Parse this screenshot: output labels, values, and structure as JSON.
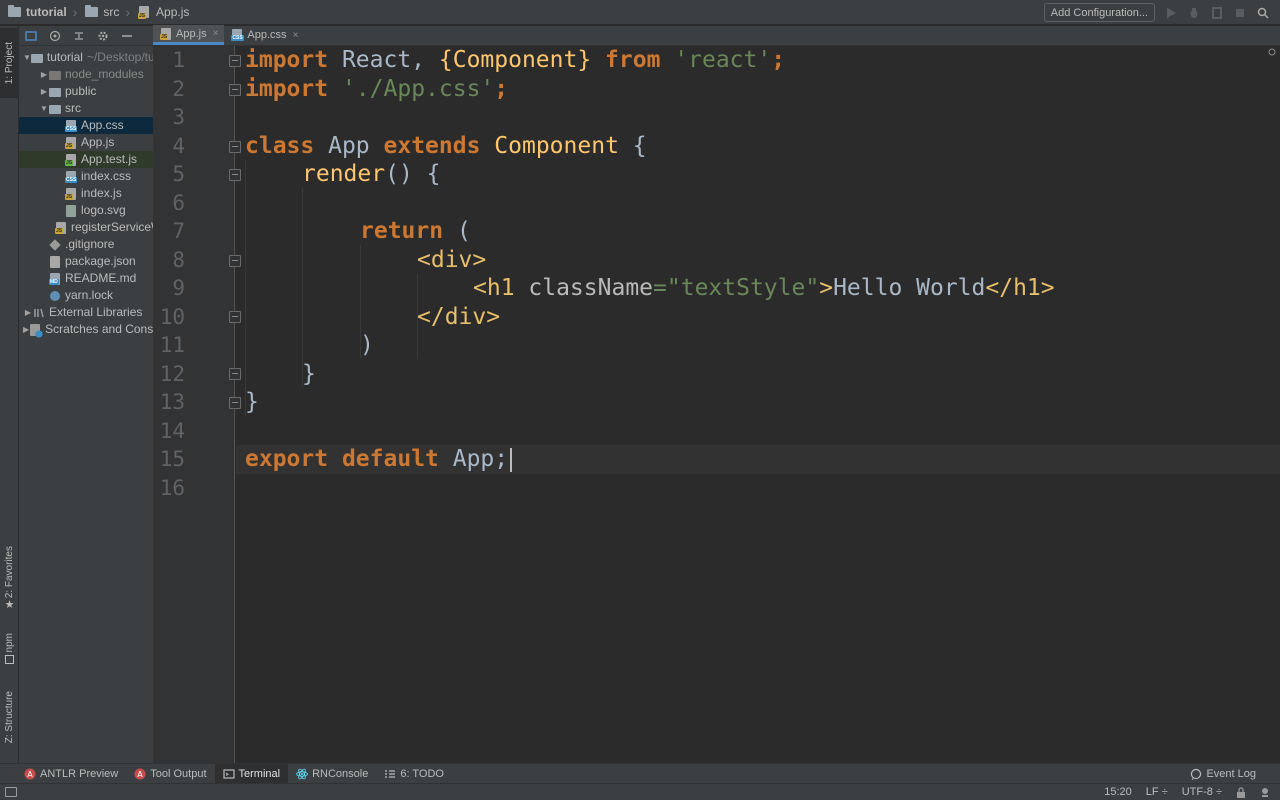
{
  "breadcrumb": {
    "items": [
      {
        "label": "tutorial",
        "icon": "folder-icon"
      },
      {
        "label": "src",
        "icon": "folder-icon"
      },
      {
        "label": "App.js",
        "icon": "js-file-icon"
      }
    ]
  },
  "toolbar": {
    "add_configuration": "Add Configuration..."
  },
  "left_stripe": {
    "project": "1: Project",
    "favorites": "2: Favorites",
    "npm": "npm",
    "structure": "Z: Structure"
  },
  "project_tree": [
    {
      "label": "tutorial",
      "hint": "~/Desktop/tutorial",
      "indent": 0,
      "expanded": true,
      "icon": "folder-icon"
    },
    {
      "label": "node_modules",
      "indent": 1,
      "expanded": false,
      "icon": "folder-icon",
      "muted": true
    },
    {
      "label": "public",
      "indent": 1,
      "expanded": false,
      "icon": "folder-icon"
    },
    {
      "label": "src",
      "indent": 1,
      "expanded": true,
      "icon": "folder-icon"
    },
    {
      "label": "App.css",
      "indent": 2,
      "icon": "css-file-icon",
      "selected": true
    },
    {
      "label": "App.js",
      "indent": 2,
      "icon": "js-file-icon"
    },
    {
      "label": "App.test.js",
      "indent": 2,
      "icon": "test-file-icon",
      "highlight": true
    },
    {
      "label": "index.css",
      "indent": 2,
      "icon": "css-file-icon"
    },
    {
      "label": "index.js",
      "indent": 2,
      "icon": "js-file-icon"
    },
    {
      "label": "logo.svg",
      "indent": 2,
      "icon": "svg-file-icon"
    },
    {
      "label": "registerServiceWorker.js",
      "indent": 2,
      "icon": "js-file-icon"
    },
    {
      "label": ".gitignore",
      "indent": 1,
      "icon": "git-icon"
    },
    {
      "label": "package.json",
      "indent": 1,
      "icon": "json-file-icon"
    },
    {
      "label": "README.md",
      "indent": 1,
      "icon": "md-file-icon"
    },
    {
      "label": "yarn.lock",
      "indent": 1,
      "icon": "yarn-icon"
    },
    {
      "label": "External Libraries",
      "indent": 0,
      "expanded": false,
      "icon": "library-icon"
    },
    {
      "label": "Scratches and Consoles",
      "indent": 0,
      "expanded": false,
      "icon": "scratches-icon"
    }
  ],
  "tabs": [
    {
      "label": "App.js",
      "active": true,
      "close": "×"
    },
    {
      "label": "App.css",
      "active": false,
      "close": "×"
    }
  ],
  "editor": {
    "line_numbers": [
      "1",
      "2",
      "3",
      "4",
      "5",
      "6",
      "7",
      "8",
      "9",
      "10",
      "11",
      "12",
      "13",
      "14",
      "15",
      "16"
    ],
    "caret_line": 15
  },
  "code": {
    "l1": {
      "t1": "import",
      "t2": " React, ",
      "t3": "{Component}",
      "t4": " from ",
      "t5": "'react'",
      "t6": ";"
    },
    "l2": {
      "t1": "import",
      "t2": " ",
      "t3": "'./App.css'",
      "t4": ";"
    },
    "l4": {
      "t1": "class",
      "t2": " App ",
      "t3": "extends",
      "t4": " ",
      "t5": "Component",
      "t6": " {"
    },
    "l5": {
      "t1": "render",
      "t2": "() {"
    },
    "l7": {
      "t1": "return",
      "t2": " ("
    },
    "l8": {
      "t1": "<div>"
    },
    "l9": {
      "t1": "<h1 ",
      "t2": "className",
      "t3": "=",
      "t4": "\"textStyle\"",
      "t5": ">",
      "t6": "Hello World",
      "t7": "</h1>"
    },
    "l10": {
      "t1": "</div>"
    },
    "l11": {
      "t1": ")"
    },
    "l12": {
      "t1": "}"
    },
    "l13": {
      "t1": "}"
    },
    "l15": {
      "t1": "export",
      "t2": " ",
      "t3": "default",
      "t4": " App;"
    }
  },
  "bottom_tools": [
    {
      "label": "ANTLR Preview",
      "icon": "antlr-icon"
    },
    {
      "label": "Tool Output",
      "icon": "antlr-icon"
    },
    {
      "label": "Terminal",
      "icon": "terminal-icon",
      "active": true
    },
    {
      "label": "RNConsole",
      "icon": "react-icon"
    },
    {
      "label": "6: TODO",
      "icon": "todo-icon"
    }
  ],
  "event_log": "Event Log",
  "status": {
    "position": "15:20",
    "line_separator": "LF ÷",
    "encoding": "UTF-8 ÷"
  },
  "colors": {
    "accent": "#4a88c7",
    "keyword": "#cc7832",
    "string": "#6a8759",
    "tag": "#e8bf6a",
    "class": "#ffc66d",
    "text": "#a9b7c6",
    "background": "#2b2b2b"
  }
}
